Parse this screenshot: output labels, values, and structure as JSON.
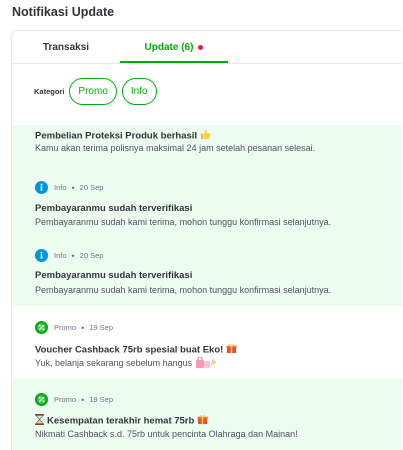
{
  "page": {
    "title": "Notifikasi Update"
  },
  "tabs": [
    {
      "label": "Transaksi",
      "active": false
    },
    {
      "label": "Update (6)",
      "active": true
    }
  ],
  "filter": {
    "label": "Kategori",
    "chips": [
      "Promo",
      "Info"
    ]
  },
  "notifications": [
    {
      "category": "",
      "date": "",
      "title": "Pembelian Proteksi Produk berhasil",
      "title_emoji": "thumbs-up-icon",
      "body": "Kamu akan terima polisnya maksimal 24 jam setelah pesanan selesai.",
      "unread": true
    },
    {
      "category": "Info",
      "date": "20 Sep",
      "icon": "info-icon",
      "title": "Pembayaranmu sudah terverifikasi",
      "body": "Pembayaranmu sudah kami terima, mohon tunggu konfirmasi selanjutnya.",
      "unread": true
    },
    {
      "category": "Info",
      "date": "20 Sep",
      "icon": "info-icon",
      "title": "Pembayaranmu sudah terverifikasi",
      "body": "Pembayaranmu sudah kami terima, mohon tunggu konfirmasi selanjutnya.",
      "unread": true
    },
    {
      "category": "Promo",
      "date": "19 Sep",
      "icon": "promo-icon",
      "title": "Voucher Cashback 75rb spesial buat Eko!",
      "title_emoji": "gift-icon",
      "body": "Yuk, belanja sekarang sebelum hangus",
      "body_emoji": "shopping-bags-icon",
      "unread": false
    },
    {
      "category": "Promo",
      "date": "19 Sep",
      "icon": "promo-icon",
      "title": "Kesempatan terakhir hemat 75rb",
      "title_prefix_emoji": "hourglass-icon",
      "title_emoji": "gift-icon",
      "body": "Nikmati Cashback s.d. 75rb untuk pencinta Olahraga dan Mainan!",
      "unread": true
    }
  ],
  "colors": {
    "brand_green": "#03ac0e",
    "unread_bg": "#ecfcee",
    "info_blue": "#0095da",
    "badge_red": "#ef144a",
    "text_dark": "#31353b"
  }
}
